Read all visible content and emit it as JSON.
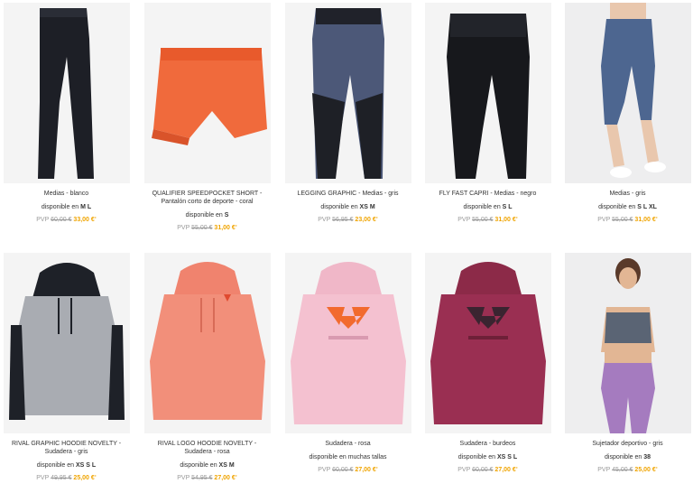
{
  "products": [
    {
      "name": "Medias - blanco",
      "avail_prefix": "disponible en ",
      "sizes": "M L",
      "pvp": "PVP",
      "old_price": "60,00 €",
      "new_price": "33,00 €",
      "asterisk": "*"
    },
    {
      "name": "QUALIFIER SPEEDPOCKET SHORT - Pantalón corto de deporte - coral",
      "avail_prefix": "disponible en ",
      "sizes": "S",
      "pvp": "PVP",
      "old_price": "55,00 €",
      "new_price": "31,00 €",
      "asterisk": "*"
    },
    {
      "name": "LEGGING GRAPHIC - Medias - gris",
      "avail_prefix": "disponible en ",
      "sizes": "XS M",
      "pvp": "PVP",
      "old_price": "56,95 €",
      "new_price": "23,00 €",
      "asterisk": "*"
    },
    {
      "name": "FLY FAST CAPRI - Medias - negro",
      "avail_prefix": "disponible en ",
      "sizes": "S L",
      "pvp": "PVP",
      "old_price": "55,00 €",
      "new_price": "31,00 €",
      "asterisk": "*"
    },
    {
      "name": "Medias - gris",
      "avail_prefix": "disponible en ",
      "sizes": "S L XL",
      "pvp": "PVP",
      "old_price": "55,00 €",
      "new_price": "31,00 €",
      "asterisk": "*"
    },
    {
      "name": "RIVAL GRAPHIC HOODIE NOVELTY - Sudadera - gris",
      "avail_prefix": "disponible en ",
      "sizes": "XS S L",
      "pvp": "PVP",
      "old_price": "49,95 €",
      "new_price": "25,00 €",
      "asterisk": "*"
    },
    {
      "name": "RIVAL LOGO HOODIE NOVELTY - Sudadera - rosa",
      "avail_prefix": "disponible en ",
      "sizes": "XS M",
      "pvp": "PVP",
      "old_price": "54,95 €",
      "new_price": "27,00 €",
      "asterisk": "*"
    },
    {
      "name": "Sudadera - rosa",
      "avail_prefix": "disponible en muchas tallas",
      "sizes": "",
      "pvp": "PVP",
      "old_price": "60,00 €",
      "new_price": "27,00 €",
      "asterisk": "*"
    },
    {
      "name": "Sudadera - burdeos",
      "avail_prefix": "disponible en ",
      "sizes": "XS S L",
      "pvp": "PVP",
      "old_price": "60,00 €",
      "new_price": "27,00 €",
      "asterisk": "*"
    },
    {
      "name": "Sujetador deportivo - gris",
      "avail_prefix": "disponible en ",
      "sizes": "38",
      "pvp": "PVP",
      "old_price": "45,00 €",
      "new_price": "25,00 €",
      "asterisk": "*"
    }
  ],
  "colors": {
    "accent": "#f0a400",
    "muted": "#999999",
    "text": "#333333"
  }
}
